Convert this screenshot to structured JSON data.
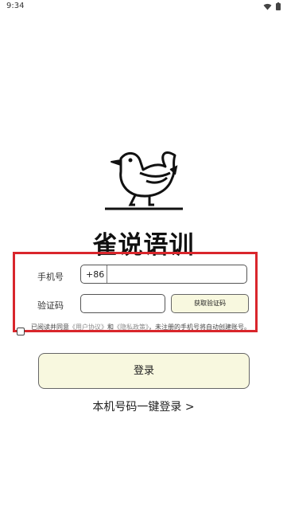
{
  "status_bar": {
    "time": "9:34",
    "icons": [
      "wifi-icon",
      "battery-icon"
    ]
  },
  "app": {
    "title": "雀说语训",
    "logo": "bird-logo"
  },
  "form": {
    "phone_label": "手机号",
    "country_code": "+86",
    "phone_value": "",
    "code_label": "验证码",
    "code_value": "",
    "get_code_label": "获取验证码"
  },
  "agreement": {
    "checked": false,
    "prefix": "已阅读并同意",
    "user_agreement": "《用户协议》",
    "and": "和",
    "privacy_policy": "《隐私政策》",
    "suffix": "，未注册的手机号将自动创建账号。"
  },
  "actions": {
    "login_label": "登录",
    "one_key_login_label": "本机号码一键登录 >"
  },
  "colors": {
    "button_fill": "#f8f8df",
    "highlight_border": "#d9262c",
    "link": "#8a8a8a"
  }
}
